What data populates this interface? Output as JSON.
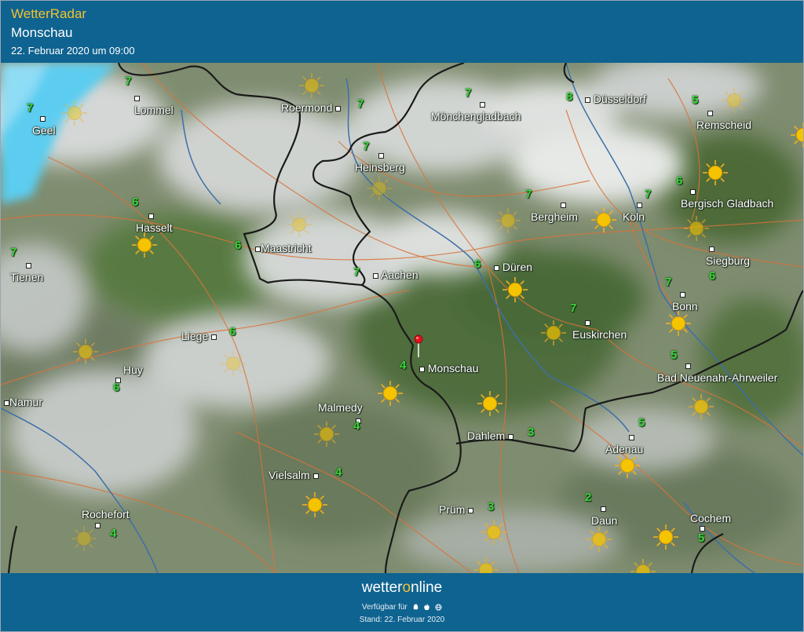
{
  "header": {
    "app_title": "WetterRadar",
    "location": "Monschau",
    "datetime": "22. Februar 2020 um 09:00"
  },
  "map": {
    "cities": [
      {
        "name": "Lommel"
      },
      {
        "name": "Roermond"
      },
      {
        "name": "Düsseldorf"
      },
      {
        "name": "Mönchengladbach"
      },
      {
        "name": "Remscheid"
      },
      {
        "name": "Geel"
      },
      {
        "name": "Heinsberg"
      },
      {
        "name": "Bergheim"
      },
      {
        "name": "Köln"
      },
      {
        "name": "Bergisch Gladbach"
      },
      {
        "name": "Hasselt"
      },
      {
        "name": "Maastricht"
      },
      {
        "name": "Aachen"
      },
      {
        "name": "Düren"
      },
      {
        "name": "Siegburg"
      },
      {
        "name": "Tienen"
      },
      {
        "name": "Bonn"
      },
      {
        "name": "Liege"
      },
      {
        "name": "Euskirchen"
      },
      {
        "name": "Huy"
      },
      {
        "name": "Monschau"
      },
      {
        "name": "Bad Neuenahr-Ahrweiler"
      },
      {
        "name": "Namur"
      },
      {
        "name": "Malmedy"
      },
      {
        "name": "Dahlem"
      },
      {
        "name": "Adenau"
      },
      {
        "name": "Vielsalm"
      },
      {
        "name": "Rochefort"
      },
      {
        "name": "Prüm"
      },
      {
        "name": "Daun"
      },
      {
        "name": "Cochem"
      }
    ],
    "temperatures": [
      "7",
      "7",
      "7",
      "8",
      "5",
      "7",
      "7",
      "7",
      "7",
      "6",
      "6",
      "7",
      "6",
      "7",
      "6",
      "6",
      "7",
      "7",
      "6",
      "4",
      "5",
      "4",
      "3",
      "4",
      "3",
      "2",
      "5"
    ],
    "weather_icons": [
      "sun-icon"
    ],
    "marker": "location-pin-icon"
  },
  "footer": {
    "brand_prefix": "wetter",
    "brand_o": "o",
    "brand_suffix": "nline",
    "available_label": "Verfügbar für",
    "platform_icons": [
      "android-icon",
      "apple-icon",
      "web-icon"
    ],
    "stand_label": "Stand: 22. Februar 2020"
  },
  "colors": {
    "header_bg": "#0f6390",
    "title_accent": "#f2c230",
    "temperature": "#3bd43b",
    "border": "#1a1a1a",
    "road": "#d9733a",
    "river": "#3d6fa8",
    "rain": "#5ccdf0"
  }
}
